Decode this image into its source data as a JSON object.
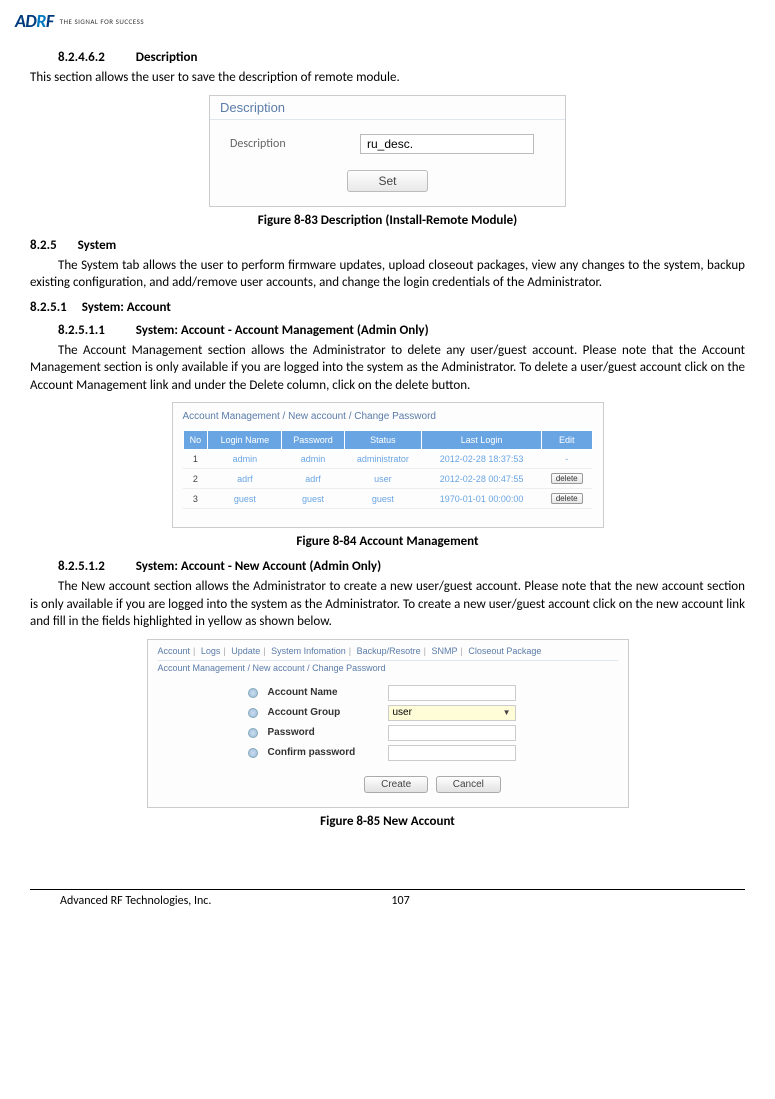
{
  "logo": {
    "brand": "ADRF",
    "tagline": "THE SIGNAL FOR SUCCESS"
  },
  "s1": {
    "num": "8.2.4.6.2",
    "title": "Description",
    "text": "This section allows the user to save the description of remote module."
  },
  "fig83": {
    "panel_title": "Description",
    "label": "Description",
    "value": "ru_desc.",
    "button": "Set",
    "caption": "Figure 8-83    Description (Install-Remote Module)"
  },
  "s2": {
    "num": "8.2.5",
    "title": "System",
    "text": "The System tab allows the user to perform firmware updates, upload closeout packages, view any changes to the system, backup existing configuration, and add/remove user accounts, and change the login credentials of the Administrator."
  },
  "s3": {
    "num": "8.2.5.1",
    "title": "System: Account"
  },
  "s4": {
    "num": "8.2.5.1.1",
    "title": "System: Account - Account Management (Admin Only)",
    "text": "The Account Management section allows the Administrator to delete any user/guest account.  Please note that the Account Management section is only available if you are logged into the system as the Administrator.  To delete a user/guest account click on the Account Management link and under the Delete column, click on the delete button."
  },
  "fig84": {
    "breadcrumb": "Account Management / New account / Change Password",
    "headers": [
      "No",
      "Login Name",
      "Password",
      "Status",
      "Last Login",
      "Edit"
    ],
    "rows": [
      {
        "no": "1",
        "login": "admin",
        "pw": "admin",
        "status": "administrator",
        "last": "2012-02-28 18:37:53",
        "edit": "-"
      },
      {
        "no": "2",
        "login": "adrf",
        "pw": "adrf",
        "status": "user",
        "last": "2012-02-28 00:47:55",
        "edit": "delete"
      },
      {
        "no": "3",
        "login": "guest",
        "pw": "guest",
        "status": "guest",
        "last": "1970-01-01 00:00:00",
        "edit": "delete"
      }
    ],
    "caption": "Figure 8-84    Account Management"
  },
  "s5": {
    "num": "8.2.5.1.2",
    "title": "System: Account - New Account (Admin Only)",
    "text": "The New account section allows the Administrator to create a new user/guest account.  Please note that the new account section is only available if you are logged into the system as the Administrator.  To create a new user/guest account click on the new account link and fill in the fields highlighted in yellow as shown below."
  },
  "fig85": {
    "tabs": [
      "Account",
      "Logs",
      "Update",
      "System Infomation",
      "Backup/Resotre",
      "SNMP",
      "Closeout Package"
    ],
    "breadcrumb": "Account Management / New account / Change Password",
    "fields": {
      "name_label": "Account Name",
      "group_label": "Account Group",
      "group_value": "user",
      "pw_label": "Password",
      "cpw_label": "Confirm password"
    },
    "buttons": {
      "create": "Create",
      "cancel": "Cancel"
    },
    "caption": "Figure 8-85    New Account"
  },
  "footer": {
    "company": "Advanced RF Technologies, Inc.",
    "page": "107"
  }
}
